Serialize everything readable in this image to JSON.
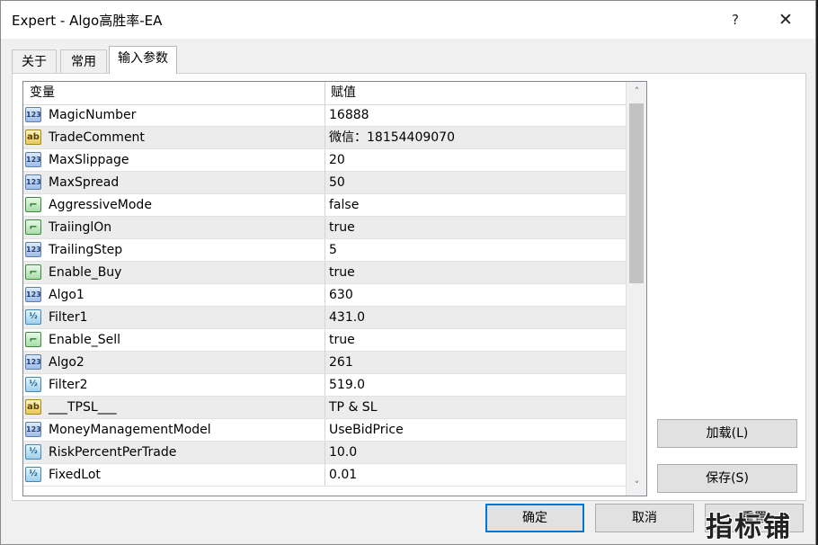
{
  "window": {
    "title": "Expert - Algo高胜率-EA",
    "help_label": "?",
    "close_label": "✕"
  },
  "tabs": [
    {
      "label": "关于"
    },
    {
      "label": "常用"
    },
    {
      "label": "输入参数"
    }
  ],
  "grid": {
    "columns": [
      "变量",
      "赋值"
    ],
    "rows": [
      {
        "type": "int",
        "icon": "123",
        "name": "MagicNumber",
        "value": "16888"
      },
      {
        "type": "string",
        "icon": "ab",
        "name": "TradeComment",
        "value": "微信：18154409070"
      },
      {
        "type": "int",
        "icon": "123",
        "name": "MaxSlippage",
        "value": "20"
      },
      {
        "type": "int",
        "icon": "123",
        "name": "MaxSpread",
        "value": "50"
      },
      {
        "type": "bool",
        "icon": "⌐",
        "name": "AggressiveMode",
        "value": "false"
      },
      {
        "type": "bool",
        "icon": "⌐",
        "name": "TraiinglOn",
        "value": "true"
      },
      {
        "type": "int",
        "icon": "123",
        "name": "TrailingStep",
        "value": "5"
      },
      {
        "type": "bool",
        "icon": "⌐",
        "name": "Enable_Buy",
        "value": "true"
      },
      {
        "type": "int",
        "icon": "123",
        "name": "Algo1",
        "value": "630"
      },
      {
        "type": "double",
        "icon": "½",
        "name": "Filter1",
        "value": "431.0"
      },
      {
        "type": "bool",
        "icon": "⌐",
        "name": "Enable_Sell",
        "value": "true"
      },
      {
        "type": "int",
        "icon": "123",
        "name": "Algo2",
        "value": "261"
      },
      {
        "type": "double",
        "icon": "½",
        "name": "Filter2",
        "value": "519.0"
      },
      {
        "type": "string",
        "icon": "ab",
        "name": "___TPSL___",
        "value": "TP & SL"
      },
      {
        "type": "int",
        "icon": "123",
        "name": "MoneyManagementModel",
        "value": "UseBidPrice"
      },
      {
        "type": "double",
        "icon": "½",
        "name": "RiskPercentPerTrade",
        "value": "10.0"
      },
      {
        "type": "double",
        "icon": "½",
        "name": "FixedLot",
        "value": "0.01"
      }
    ],
    "scroll_up": "˄",
    "scroll_down": "˅"
  },
  "buttons": {
    "load": "加载(L)",
    "save": "保存(S)",
    "ok": "确定",
    "cancel": "取消",
    "reset": "重置"
  },
  "watermark": "指标铺"
}
